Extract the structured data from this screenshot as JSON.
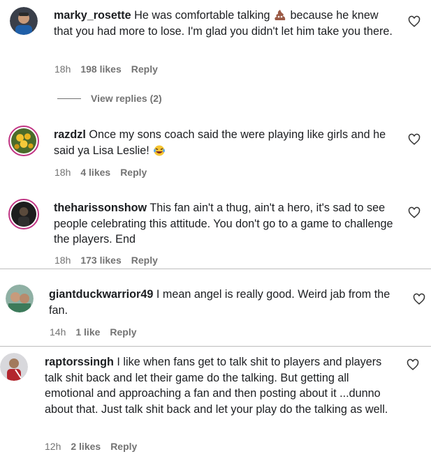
{
  "comments": [
    {
      "username": "marky_rosette",
      "text_before": " He was comfortable talking ",
      "text_after": " because he knew that you had more to lose. I'm glad you didn't let him take you there.",
      "emoji": "poop-emoji",
      "time": "18h",
      "likes": "198 likes",
      "reply": "Reply"
    },
    {
      "username": "razdzl",
      "text_before": " Once my sons coach said the were playing like girls and he said ya Lisa Leslie! ",
      "emoji": "laughing-emoji",
      "time": "18h",
      "likes": "4 likes",
      "reply": "Reply"
    },
    {
      "username": "theharissonshow",
      "text_before": " This fan ain't a thug, ain't a hero, it's sad to see people celebrating this attitude. You don't go to a game to challenge the players. End",
      "time": "18h",
      "likes": "173 likes",
      "reply": "Reply"
    },
    {
      "username": "giantduckwarrior49",
      "text_before": " I mean angel is really good. Weird jab from the fan.",
      "time": "14h",
      "likes": "1 like",
      "reply": "Reply"
    },
    {
      "username": "raptorssingh",
      "text_before": " I like when fans get to talk shit to players and players talk shit back and let their game do the talking. But getting all emotional and approaching a fan and then posting about it ...dunno about that. Just talk shit back and let your play do the talking as well.",
      "time": "12h",
      "likes": "2 likes",
      "reply": "Reply"
    }
  ],
  "view_replies": "View replies (2)",
  "icons": {
    "like": "heart-icon"
  }
}
